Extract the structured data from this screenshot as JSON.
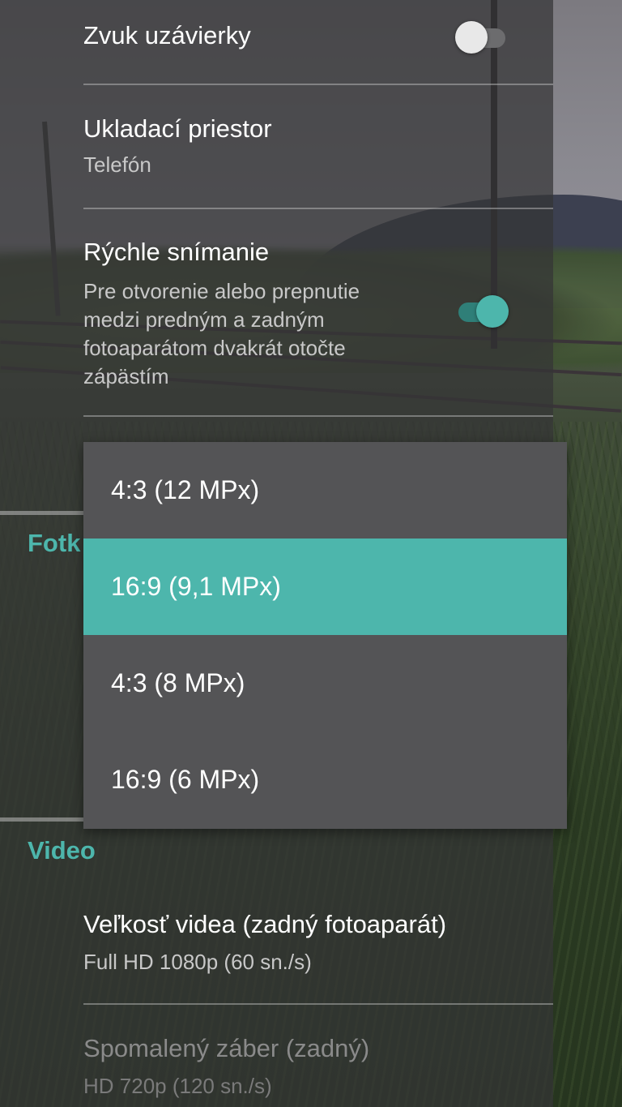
{
  "settings": {
    "shutter_sound": {
      "title": "Zvuk uzávierky",
      "enabled": false
    },
    "storage": {
      "title": "Ukladací priestor",
      "summary": "Telefón"
    },
    "quick_capture": {
      "title": "Rýchle snímanie",
      "summary_lines": [
        "Pre otvorenie alebo prepnutie",
        "medzi predným a zadným",
        "fotoaparátom dvakrát otočte",
        "zápästím"
      ],
      "enabled": true
    },
    "photo_section": {
      "header_visible_fragment": "Fotk"
    },
    "video_section": {
      "header": "Video",
      "video_size": {
        "title": "Veľkosť videa (zadný fotoaparát)",
        "summary": "Full HD 1080p (60 sn./s)"
      },
      "slow_motion": {
        "title": "Spomalený záber (zadný)",
        "summary": "HD 720p (120 sn./s)",
        "enabled": false
      }
    }
  },
  "dropdown": {
    "options": [
      {
        "label": "4:3 (12 MPx)",
        "selected": false
      },
      {
        "label": "16:9 (9,1 MPx)",
        "selected": true
      },
      {
        "label": "4:3 (8 MPx)",
        "selected": false
      },
      {
        "label": "16:9 (6 MPx)",
        "selected": false
      }
    ]
  },
  "colors": {
    "accent": "#4db6ac",
    "panel": "#343436",
    "dropdown_bg": "#545456"
  }
}
